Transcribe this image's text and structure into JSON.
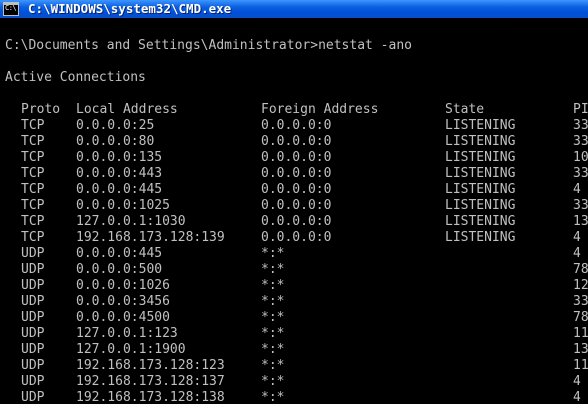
{
  "window": {
    "title": "C:\\WINDOWS\\system32\\CMD.exe",
    "icon": "cmd-icon",
    "icon_text": "C:\\"
  },
  "console": {
    "prompt_line": "C:\\Documents and Settings\\Administrator>netstat -ano",
    "section_title": "Active Connections",
    "headers": {
      "proto": "Proto",
      "local": "Local Address",
      "foreign": "Foreign Address",
      "state": "State",
      "pid": "PI"
    },
    "rows": [
      {
        "proto": "TCP",
        "local": "0.0.0.0:25",
        "foreign": "0.0.0.0:0",
        "state": "LISTENING",
        "pid": "33"
      },
      {
        "proto": "TCP",
        "local": "0.0.0.0:80",
        "foreign": "0.0.0.0:0",
        "state": "LISTENING",
        "pid": "33"
      },
      {
        "proto": "TCP",
        "local": "0.0.0.0:135",
        "foreign": "0.0.0.0:0",
        "state": "LISTENING",
        "pid": "10"
      },
      {
        "proto": "TCP",
        "local": "0.0.0.0:443",
        "foreign": "0.0.0.0:0",
        "state": "LISTENING",
        "pid": "33"
      },
      {
        "proto": "TCP",
        "local": "0.0.0.0:445",
        "foreign": "0.0.0.0:0",
        "state": "LISTENING",
        "pid": "4"
      },
      {
        "proto": "TCP",
        "local": "0.0.0.0:1025",
        "foreign": "0.0.0.0:0",
        "state": "LISTENING",
        "pid": "33"
      },
      {
        "proto": "TCP",
        "local": "127.0.0.1:1030",
        "foreign": "0.0.0.0:0",
        "state": "LISTENING",
        "pid": "13"
      },
      {
        "proto": "TCP",
        "local": "192.168.173.128:139",
        "foreign": "0.0.0.0:0",
        "state": "LISTENING",
        "pid": "4"
      },
      {
        "proto": "UDP",
        "local": "0.0.0.0:445",
        "foreign": "*:*",
        "state": "",
        "pid": "4"
      },
      {
        "proto": "UDP",
        "local": "0.0.0.0:500",
        "foreign": "*:*",
        "state": "",
        "pid": "78"
      },
      {
        "proto": "UDP",
        "local": "0.0.0.0:1026",
        "foreign": "*:*",
        "state": "",
        "pid": "12"
      },
      {
        "proto": "UDP",
        "local": "0.0.0.0:3456",
        "foreign": "*:*",
        "state": "",
        "pid": "33"
      },
      {
        "proto": "UDP",
        "local": "0.0.0.0:4500",
        "foreign": "*:*",
        "state": "",
        "pid": "78"
      },
      {
        "proto": "UDP",
        "local": "127.0.0.1:123",
        "foreign": "*:*",
        "state": "",
        "pid": "11"
      },
      {
        "proto": "UDP",
        "local": "127.0.0.1:1900",
        "foreign": "*:*",
        "state": "",
        "pid": "13"
      },
      {
        "proto": "UDP",
        "local": "192.168.173.128:123",
        "foreign": "*:*",
        "state": "",
        "pid": "11"
      },
      {
        "proto": "UDP",
        "local": "192.168.173.128:137",
        "foreign": "*:*",
        "state": "",
        "pid": "4"
      },
      {
        "proto": "UDP",
        "local": "192.168.173.128:138",
        "foreign": "*:*",
        "state": "",
        "pid": "4"
      }
    ]
  },
  "colors": {
    "console_bg": "#000000",
    "console_text": "#c0c0c0",
    "titlebar": "#0a5fe0",
    "title_text": "#ffffff"
  }
}
